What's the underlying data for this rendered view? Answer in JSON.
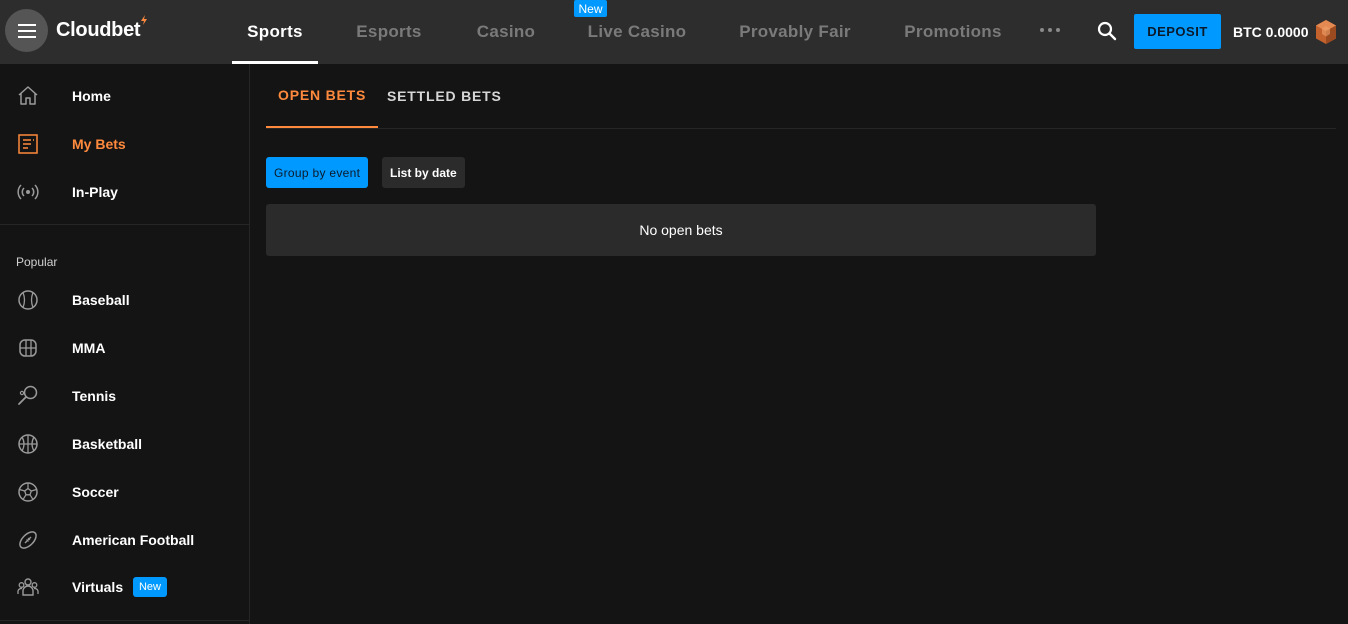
{
  "header": {
    "brand": "Cloudbet",
    "nav": [
      {
        "label": "Sports",
        "active": true
      },
      {
        "label": "Esports"
      },
      {
        "label": "Casino"
      },
      {
        "label": "Live Casino",
        "badge": "New"
      },
      {
        "label": "Provably Fair"
      },
      {
        "label": "Promotions"
      }
    ],
    "deposit_label": "DEPOSIT",
    "balance": "BTC 0.0000"
  },
  "sidebar": {
    "main_items": [
      {
        "label": "Home",
        "icon": "home-icon"
      },
      {
        "label": "My Bets",
        "icon": "receipt-icon",
        "active": true
      },
      {
        "label": "In-Play",
        "icon": "broadcast-icon"
      }
    ],
    "popular_heading": "Popular",
    "popular_items": [
      {
        "label": "Baseball",
        "icon": "baseball-icon"
      },
      {
        "label": "MMA",
        "icon": "mma-glove-icon"
      },
      {
        "label": "Tennis",
        "icon": "tennis-racket-icon"
      },
      {
        "label": "Basketball",
        "icon": "basketball-icon"
      },
      {
        "label": "Soccer",
        "icon": "soccer-ball-icon"
      },
      {
        "label": "American Football",
        "icon": "american-football-icon"
      },
      {
        "label": "Virtuals",
        "icon": "virtuals-icon",
        "badge": "New"
      }
    ]
  },
  "main": {
    "tabs": [
      {
        "label": "OPEN BETS",
        "active": true
      },
      {
        "label": "SETTLED BETS"
      }
    ],
    "view_buttons": {
      "group_by_event": "Group by event",
      "list_by_date": "List by date"
    },
    "empty_message": "No open bets"
  },
  "colors": {
    "accent_orange": "#ff8a3d",
    "primary_blue": "#0099ff",
    "topbar_bg": "#2d2d2d",
    "page_bg": "#141414"
  }
}
